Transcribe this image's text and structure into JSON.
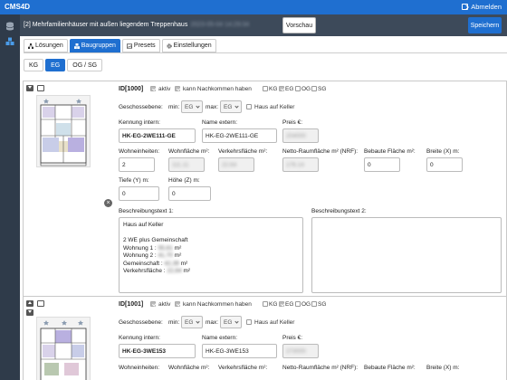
{
  "app": {
    "brand": "CMS4D",
    "logout": "Abmelden"
  },
  "header": {
    "title": "[2] Mehrfamilienhäuser mit außen liegendem Treppenhaus",
    "timestamp": "2023-05-04 14:29:34",
    "preview_label": "Vorschau",
    "save_label": "Speichern"
  },
  "tabs": [
    {
      "label": "Lösungen",
      "icon": "sitemap-icon"
    },
    {
      "label": "Baugruppen",
      "icon": "cubes-icon"
    },
    {
      "label": "Presets",
      "icon": "image-icon"
    },
    {
      "label": "Einstellungen",
      "icon": "cogs-icon"
    }
  ],
  "subtabs": [
    "KG",
    "EG",
    "OG / SG"
  ],
  "labels": {
    "aktiv": "aktiv",
    "nachkommen": "kann Nachkommen haben",
    "kg": "KG",
    "eg": "EG",
    "og": "OG",
    "sg": "SG",
    "geschoss": "Geschossebene:",
    "min": "min:",
    "max": "max:",
    "keller": "Haus auf Keller",
    "kennung": "Kennung intern:",
    "extern": "Name extern:",
    "preis": "Preis €:",
    "wohneinheiten": "Wohneinheiten:",
    "wohnflaeche": "Wohnfläche m²:",
    "verkehrsflaeche": "Verkehrsfläche m²:",
    "nrf": "Netto-Raumfläche m² (NRF):",
    "bebaute": "Bebaute Fläche m²:",
    "breite": "Breite (X) m:",
    "tiefe": "Tiefe (Y) m:",
    "hoehe": "Höhe (Z) m:",
    "beschreibung1": "Beschreibungstext 1:",
    "beschreibung2": "Beschreibungstext 2:"
  },
  "items": [
    {
      "id": "ID[1000]",
      "min": "EG",
      "max": "EG",
      "kennung": "HK-EG-2WE111-GE",
      "extern": "HK-EG-2WE111-GE",
      "preis": "204000",
      "wohneinheiten": "2",
      "wohnflaeche": "111.11",
      "verkehrsflaeche": "22.64",
      "nrf": "176.14",
      "bebaute": "0",
      "breite": "0",
      "tiefe": "0",
      "hoehe": "0",
      "beschreibung": {
        "line1": "Haus auf Keller",
        "line2": "2 WE plus Gemeinschaft",
        "w1_label": "Wohnung 1 :",
        "w1_value": "55,61",
        "w2_label": "Wohnung 2 :",
        "w2_value": "41,70",
        "gem_label": "Gemeinschaft :",
        "gem_value": "42,39",
        "verk_label": "Verkehrsfläche :",
        "verk_value": "22,64",
        "unit": "m²"
      }
    },
    {
      "id": "ID[1001]",
      "min": "EG",
      "max": "EG",
      "kennung": "HK-EG-3WE153",
      "extern": "HK-EG-3WE153",
      "preis": "273000"
    }
  ]
}
